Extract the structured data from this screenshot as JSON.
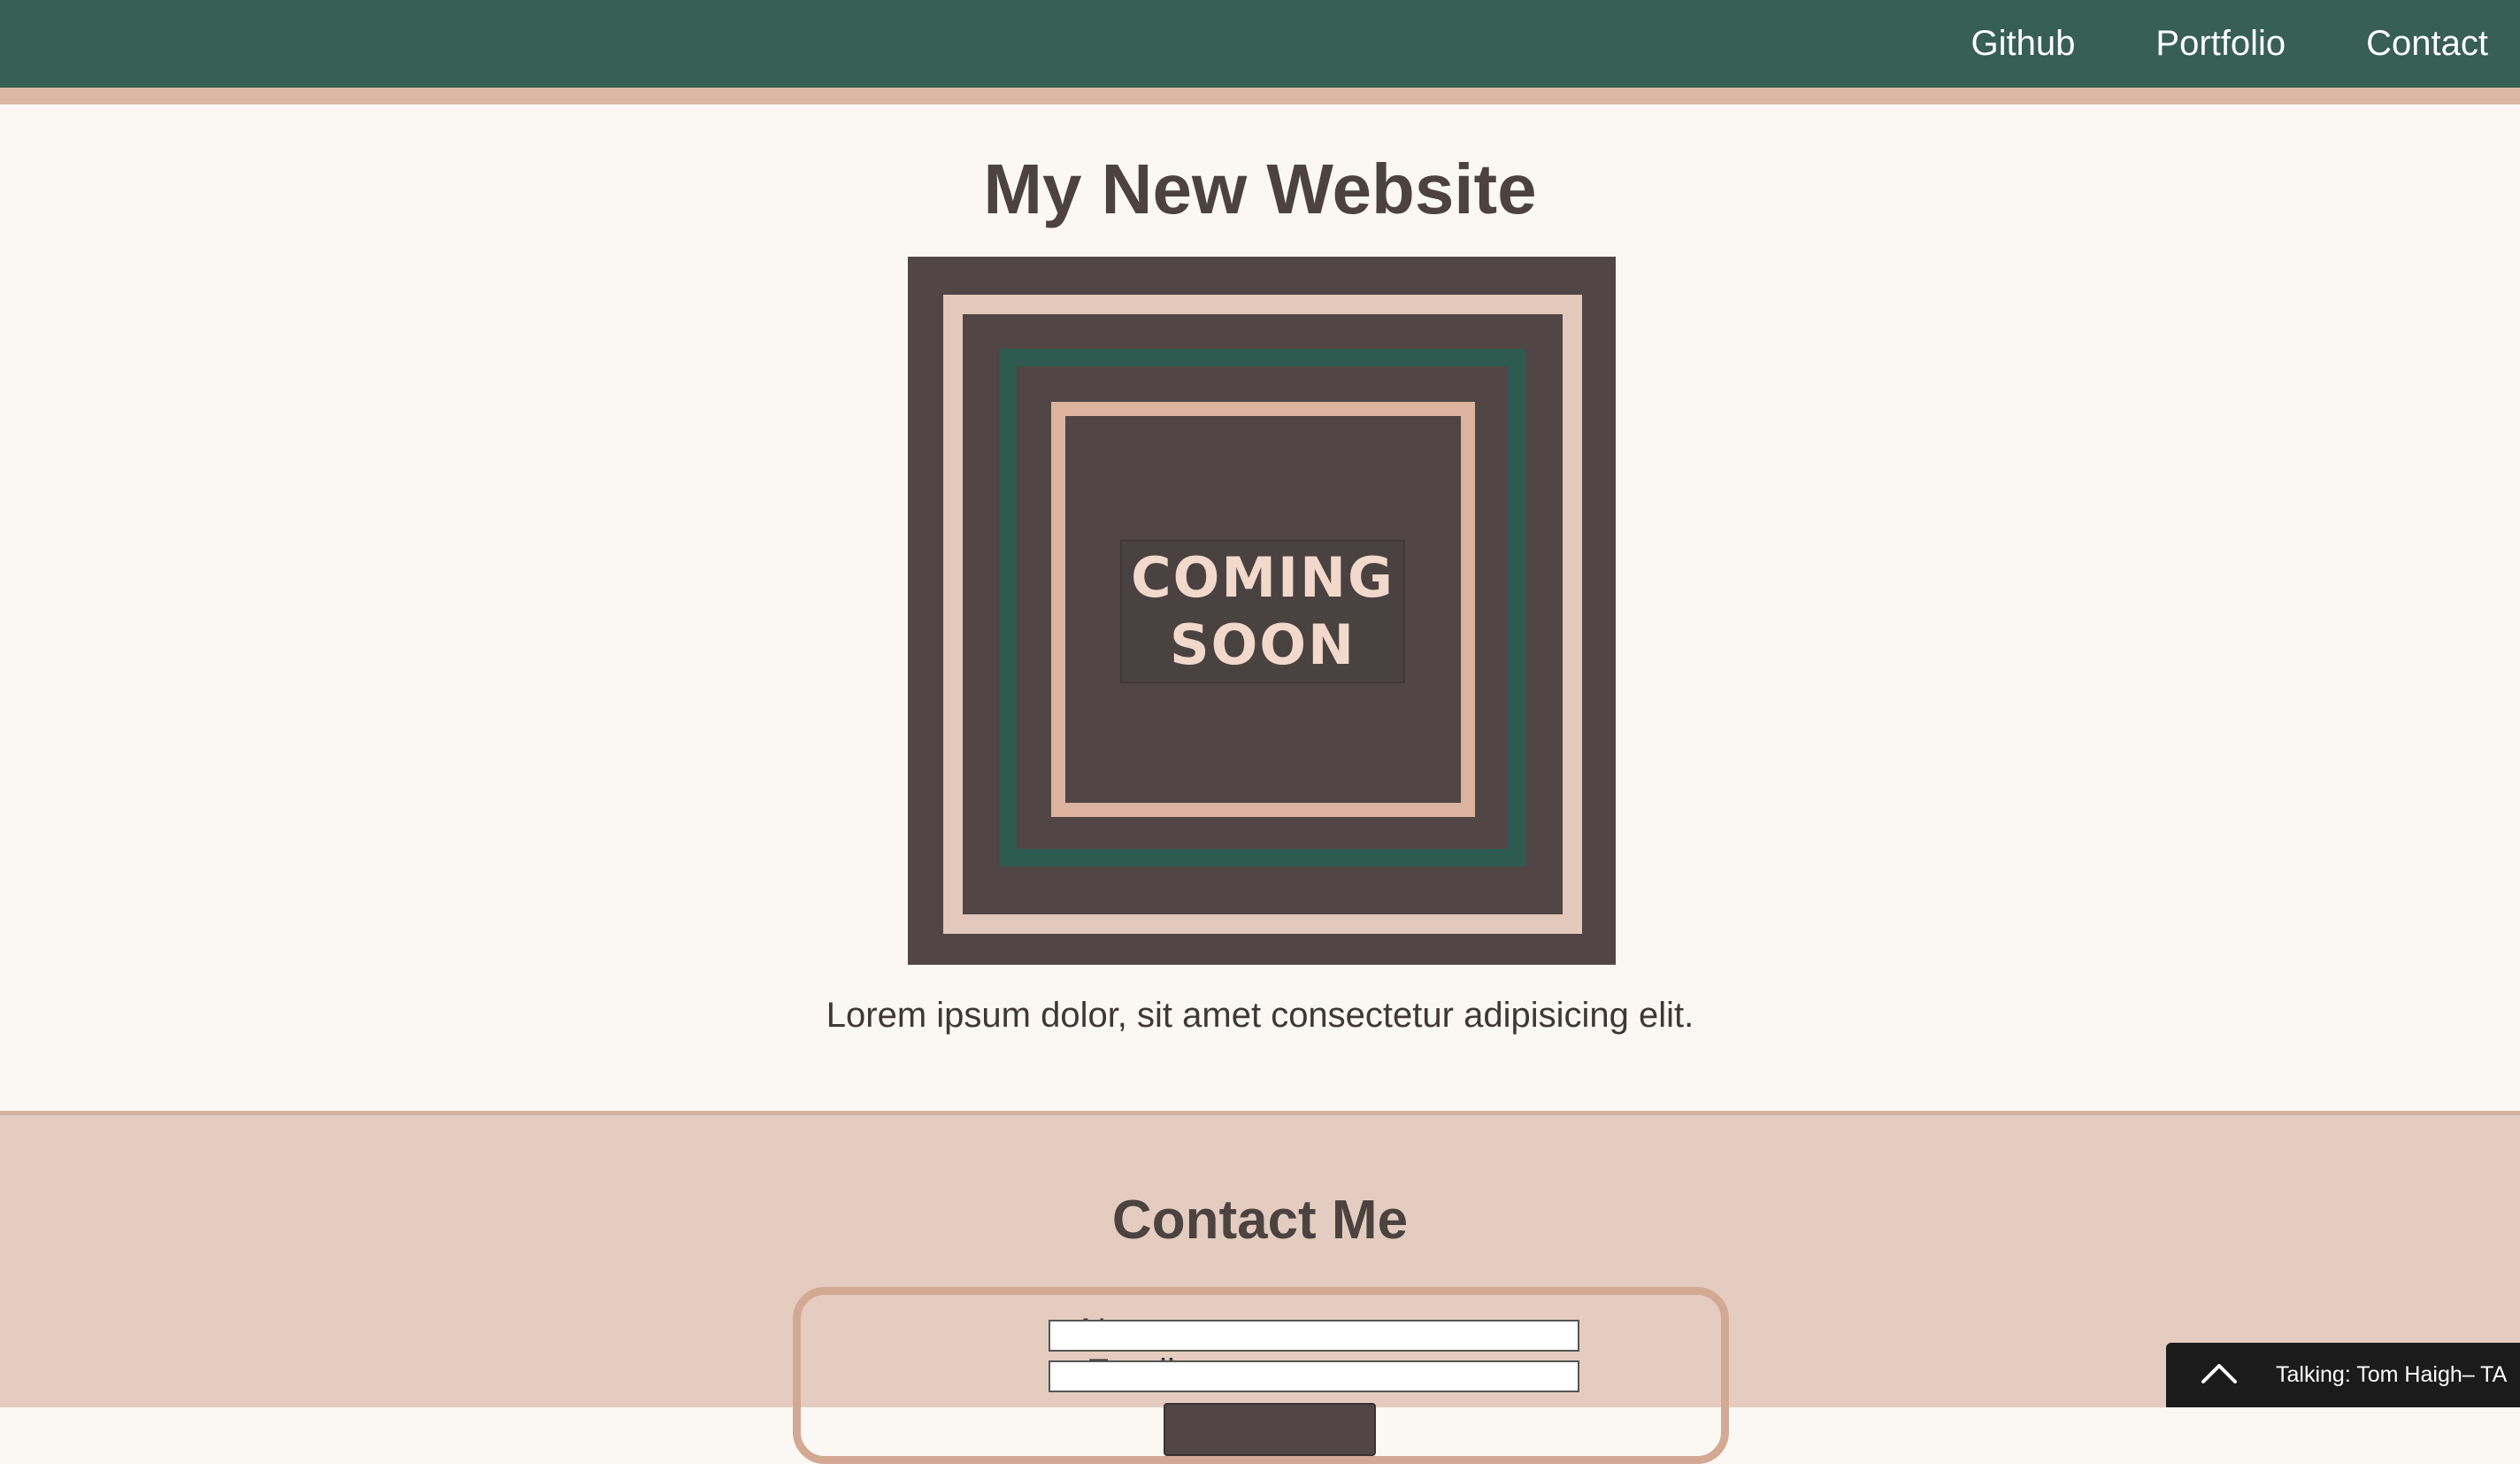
{
  "nav": {
    "links": [
      {
        "label": "Github"
      },
      {
        "label": "Portfolio"
      },
      {
        "label": "Contact"
      }
    ]
  },
  "hero": {
    "title": "My New Website",
    "image": {
      "line1": "COMING",
      "line2": "SOON"
    },
    "text": "Lorem ipsum dolor, sit amet consectetur adipisicing elit."
  },
  "contact": {
    "title": "Contact Me",
    "form": {
      "name_label": "Name:",
      "name_value": "",
      "email_label": "Email:",
      "email_value": ""
    }
  },
  "chat_bar": {
    "icon": "chevron-up-icon",
    "text": "Talking: Tom Haigh– TA"
  },
  "colors": {
    "nav_bg": "#375f53",
    "accent_peach": "#dcb7a4",
    "text_dark": "#4c4340",
    "page_bg": "#fbf7f3",
    "contact_bg": "#e4cdc0"
  }
}
